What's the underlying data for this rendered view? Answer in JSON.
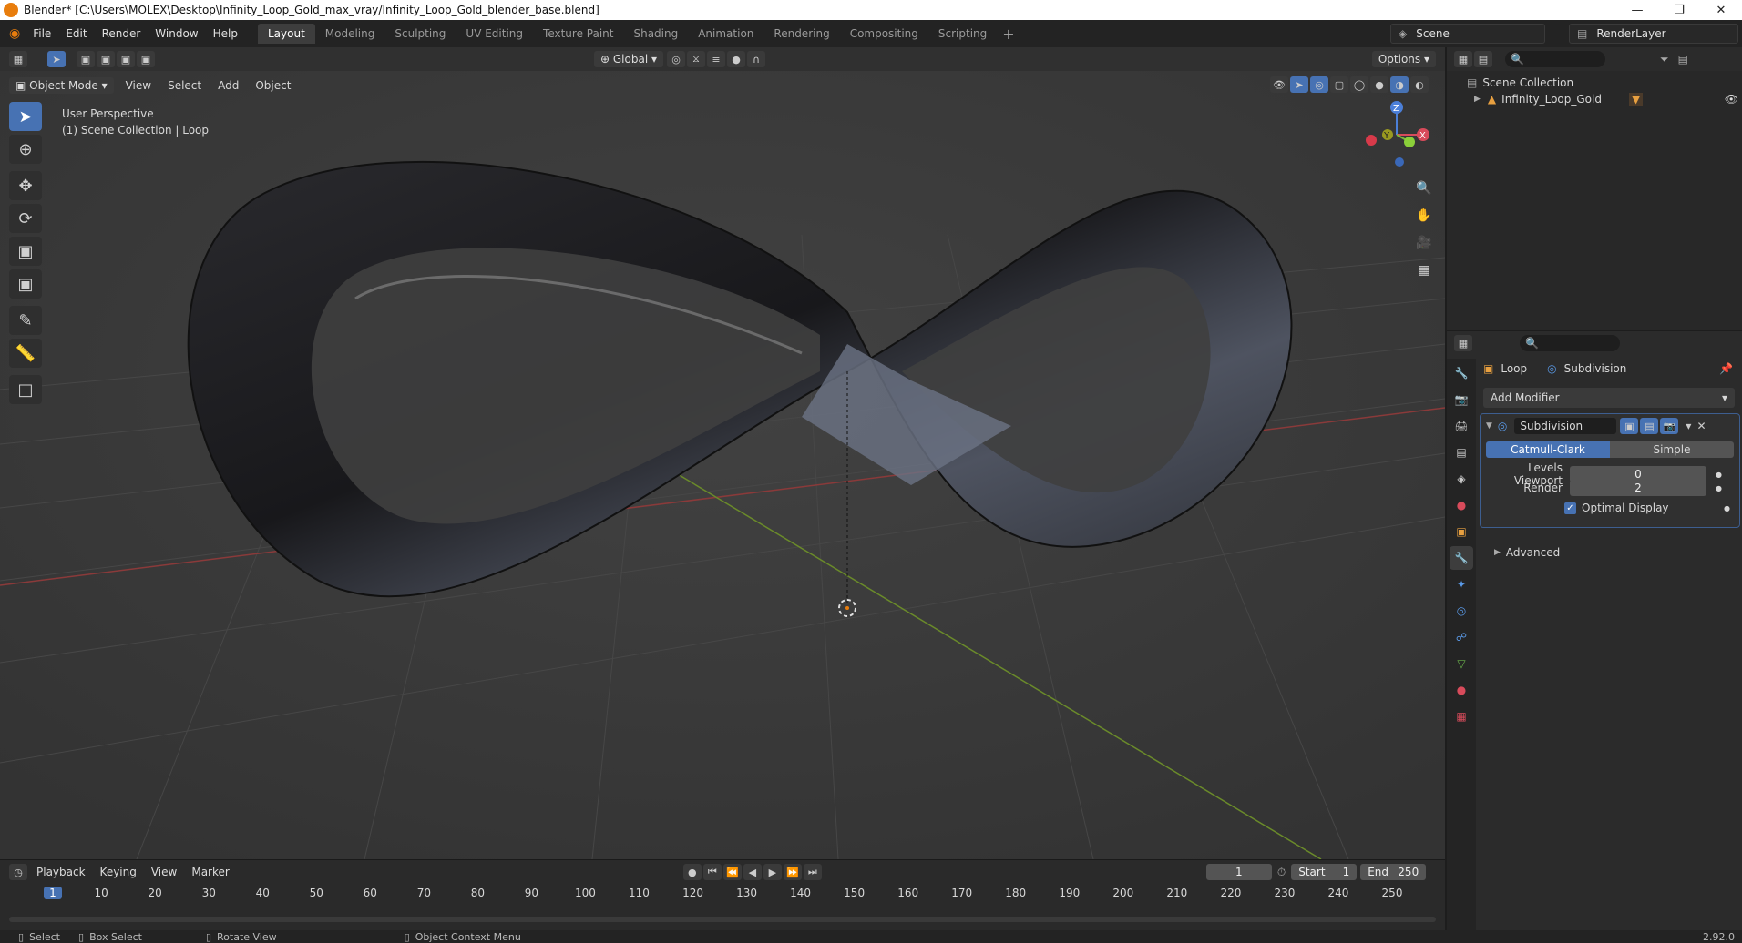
{
  "window": {
    "title": "Blender* [C:\\Users\\MOLEX\\Desktop\\Infinity_Loop_Gold_max_vray/Infinity_Loop_Gold_blender_base.blend]"
  },
  "menu": [
    "File",
    "Edit",
    "Render",
    "Window",
    "Help"
  ],
  "workspaces": [
    {
      "label": "Layout",
      "active": true
    },
    {
      "label": "Modeling"
    },
    {
      "label": "Sculpting"
    },
    {
      "label": "UV Editing"
    },
    {
      "label": "Texture Paint"
    },
    {
      "label": "Shading"
    },
    {
      "label": "Animation"
    },
    {
      "label": "Rendering"
    },
    {
      "label": "Compositing"
    },
    {
      "label": "Scripting"
    }
  ],
  "scene": {
    "name": "Scene",
    "render_layer": "RenderLayer"
  },
  "toolbar": {
    "transform": "Global",
    "options": "Options"
  },
  "viewport_header": {
    "mode": "Object Mode",
    "menus": [
      "View",
      "Select",
      "Add",
      "Object"
    ]
  },
  "viewport": {
    "overlay_line1": "User Perspective",
    "overlay_line2": "(1) Scene Collection | Loop"
  },
  "gizmo": {
    "x": "X",
    "y": "Y",
    "z": "Z"
  },
  "outliner": {
    "root": "Scene Collection",
    "item": "Infinity_Loop_Gold"
  },
  "properties": {
    "breadcrumb_object": "Loop",
    "breadcrumb_modifier": "Subdivision",
    "add_modifier": "Add Modifier",
    "modifier_name": "Subdivision",
    "method_catmull": "Catmull-Clark",
    "method_simple": "Simple",
    "levels_viewport_label": "Levels Viewport",
    "levels_viewport": "0",
    "render_label": "Render",
    "render_value": "2",
    "optimal_display": "Optimal Display",
    "advanced": "Advanced"
  },
  "timeline": {
    "menus": [
      "Playback",
      "Keying",
      "View",
      "Marker"
    ],
    "current_frame": "1",
    "start_label": "Start",
    "start": "1",
    "end_label": "End",
    "end": "250",
    "ticks": [
      "1",
      "10",
      "20",
      "30",
      "40",
      "50",
      "60",
      "70",
      "80",
      "90",
      "100",
      "110",
      "120",
      "130",
      "140",
      "150",
      "160",
      "170",
      "180",
      "190",
      "200",
      "210",
      "220",
      "230",
      "240",
      "250"
    ]
  },
  "status": {
    "select": "Select",
    "box_select": "Box Select",
    "rotate_view": "Rotate View",
    "context_menu": "Object Context Menu",
    "version": "2.92.0"
  }
}
